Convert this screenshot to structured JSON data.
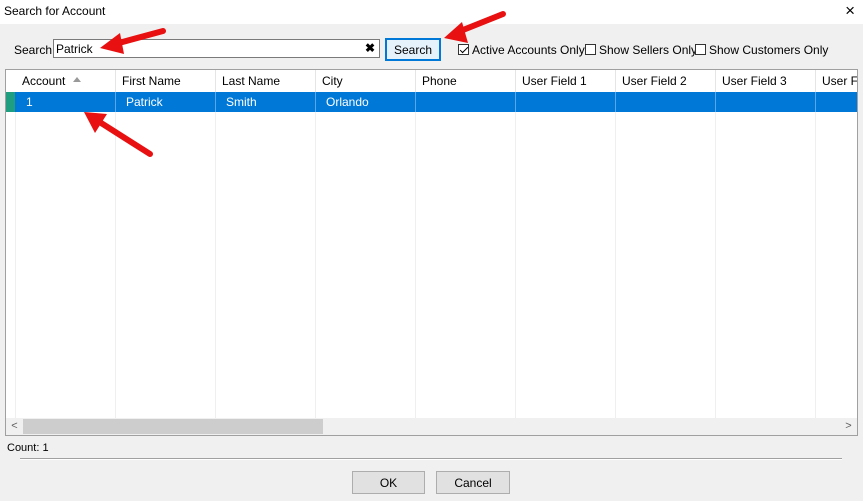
{
  "window": {
    "title": "Search for Account",
    "close_icon": "×"
  },
  "search": {
    "label": "Search",
    "value": "Patrick",
    "clear_icon": "✖",
    "button_label": "Search"
  },
  "filters": {
    "active_only": {
      "label": "Active Accounts Only",
      "checked": true
    },
    "sellers_only": {
      "label": "Show Sellers Only",
      "checked": false
    },
    "customers_only": {
      "label": "Show Customers Only",
      "checked": false
    }
  },
  "grid": {
    "columns": [
      "Account",
      "First Name",
      "Last Name",
      "City",
      "Phone",
      "User Field 1",
      "User Field 2",
      "User Field 3",
      "User F"
    ],
    "sorted_column": "Account",
    "rows": [
      [
        "1",
        "Patrick",
        "Smith",
        "Orlando",
        "",
        "",
        "",
        "",
        ""
      ]
    ],
    "scroll_left_icon": "<",
    "scroll_right_icon": ">"
  },
  "status": {
    "count": "Count: 1"
  },
  "footer": {
    "ok_label": "OK",
    "cancel_label": "Cancel"
  },
  "colors": {
    "selection": "#0078d7",
    "annotation_arrow": "#e81010",
    "row_indicator": "#1f9e80"
  }
}
